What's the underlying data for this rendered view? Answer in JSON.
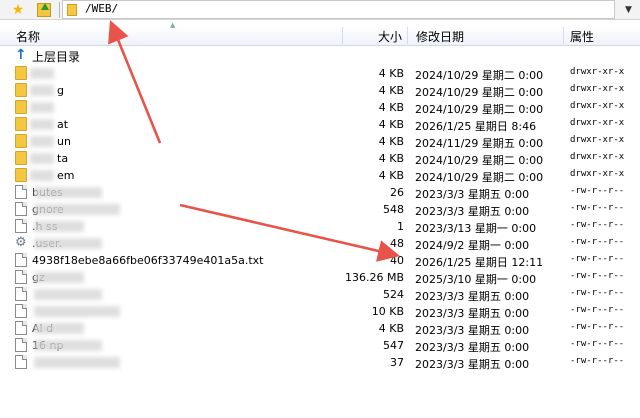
{
  "toolbar": {
    "path": "/WEB/",
    "favorite_icon": "star-icon",
    "up_icon": "folder-up-icon"
  },
  "columns": {
    "name": "名称",
    "size": "大小",
    "date": "修改日期",
    "attr": "属性"
  },
  "parent_dir": "上层目录",
  "rows": [
    {
      "name": "",
      "size": "4 KB",
      "date": "2024/10/29 星期二 0:00",
      "attr": "drwxr-xr-x",
      "type": "folder"
    },
    {
      "name": "g",
      "size": "4 KB",
      "date": "2024/10/29 星期二 0:00",
      "attr": "drwxr-xr-x",
      "type": "folder"
    },
    {
      "name": "",
      "size": "4 KB",
      "date": "2024/10/29 星期二 0:00",
      "attr": "drwxr-xr-x",
      "type": "folder"
    },
    {
      "name": "at",
      "size": "4 KB",
      "date": "2026/1/25 星期日 8:46",
      "attr": "drwxr-xr-x",
      "type": "folder"
    },
    {
      "name": "un",
      "size": "4 KB",
      "date": "2024/11/29 星期五 0:00",
      "attr": "drwxr-xr-x",
      "type": "folder"
    },
    {
      "name": "ta",
      "size": "4 KB",
      "date": "2024/10/29 星期二 0:00",
      "attr": "drwxr-xr-x",
      "type": "folder"
    },
    {
      "name": "em",
      "size": "4 KB",
      "date": "2024/10/29 星期二 0:00",
      "attr": "drwxr-xr-x",
      "type": "folder"
    },
    {
      "name": "butes",
      "size": "26",
      "date": "2023/3/3 星期五 0:00",
      "attr": "-rw-r--r--",
      "type": "file"
    },
    {
      "name": "gnore",
      "size": "548",
      "date": "2023/3/3 星期五 0:00",
      "attr": "-rw-r--r--",
      "type": "file"
    },
    {
      "name": ".h    ss",
      "size": "1",
      "date": "2023/3/13 星期一 0:00",
      "attr": "-rw-r--r--",
      "type": "file"
    },
    {
      "name": ".user.",
      "size": "48",
      "date": "2024/9/2 星期一 0:00",
      "attr": "-rw-r--r--",
      "type": "config"
    },
    {
      "name": "4938f18ebe8a66fbe06f33749e401a5a.txt",
      "size": "40",
      "date": "2026/1/25 星期日 12:11",
      "attr": "-rw-r--r--",
      "type": "file"
    },
    {
      "name": "gz",
      "size": "136.26 MB",
      "date": "2025/3/10 星期一 0:00",
      "attr": "-rw-r--r--",
      "type": "file"
    },
    {
      "name": "",
      "size": "524",
      "date": "2023/3/3 星期五 0:00",
      "attr": "-rw-r--r--",
      "type": "file"
    },
    {
      "name": "",
      "size": "10 KB",
      "date": "2023/3/3 星期五 0:00",
      "attr": "-rw-r--r--",
      "type": "file"
    },
    {
      "name": "Al    d",
      "size": "4 KB",
      "date": "2023/3/3 星期五 0:00",
      "attr": "-rw-r--r--",
      "type": "file"
    },
    {
      "name": "16    np",
      "size": "547",
      "date": "2023/3/3 星期五 0:00",
      "attr": "-rw-r--r--",
      "type": "file"
    },
    {
      "name": "",
      "size": "37",
      "date": "2023/3/3 星期五 0:00",
      "attr": "-rw-r--r--",
      "type": "file"
    }
  ],
  "annotation_color": "#e8534a"
}
